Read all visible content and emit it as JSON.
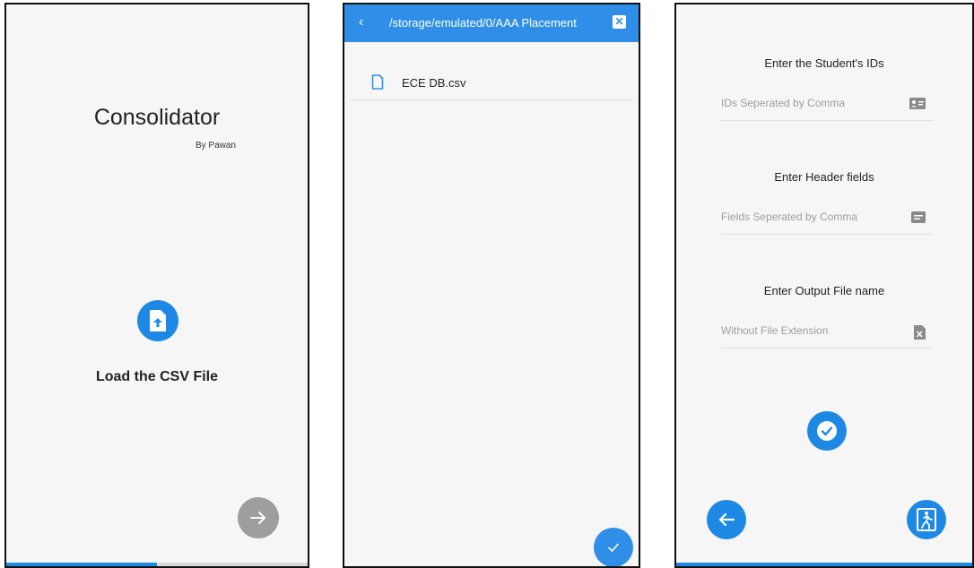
{
  "screen1": {
    "title": "Consolidator",
    "byline": "By Pawan",
    "load_label": "Load the CSV File",
    "upload_icon": "file-upload-icon",
    "next_icon": "arrow-right-icon",
    "progress_fraction": 0.5
  },
  "screen2": {
    "path": "/storage/emulated/0/AAA Placement",
    "back_glyph": "‹",
    "close_glyph": "✕",
    "files": [
      {
        "name": "ECE DB.csv",
        "icon": "file-icon"
      }
    ],
    "confirm_icon": "check-icon"
  },
  "screen3": {
    "ids_label": "Enter the Student's IDs",
    "ids_placeholder": "IDs Seperated by Comma",
    "ids_icon": "id-card-icon",
    "header_label": "Enter Header fields",
    "header_placeholder": "Fields Seperated by Comma",
    "header_icon": "text-fields-icon",
    "output_label": "Enter Output File name",
    "output_placeholder": "Without File Extension",
    "output_icon": "excel-file-icon",
    "submit_icon": "check-circle-icon",
    "back_icon": "arrow-left-icon",
    "exit_icon": "exit-door-icon"
  },
  "colors": {
    "accent": "#1e88e5",
    "appbar": "#2f8fe8",
    "disabled_fab": "#9e9e9e",
    "background": "#f6f6f6"
  }
}
